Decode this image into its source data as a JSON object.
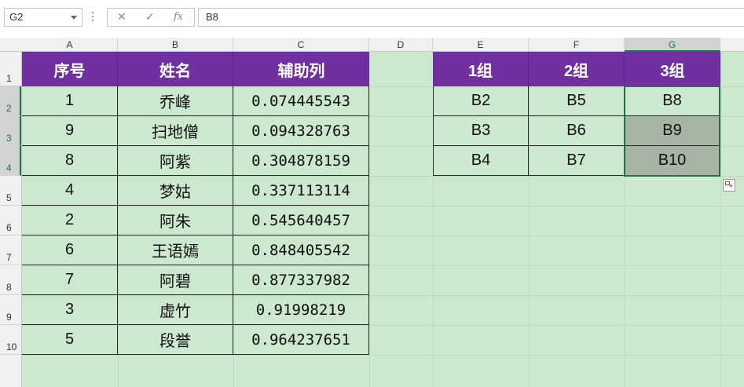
{
  "formula_bar": {
    "name_box": "G2",
    "cancel_icon": "✕",
    "enter_icon": "✓",
    "fx_label": "fx",
    "formula": "B8"
  },
  "columns": [
    "A",
    "B",
    "C",
    "D",
    "E",
    "F",
    "G"
  ],
  "rows": [
    "1",
    "2",
    "3",
    "4",
    "5",
    "6",
    "7",
    "8",
    "9",
    "10"
  ],
  "table1": {
    "headers": [
      "序号",
      "姓名",
      "辅助列"
    ],
    "rows": [
      [
        "1",
        "乔峰",
        "0.074445543"
      ],
      [
        "9",
        "扫地僧",
        "0.094328763"
      ],
      [
        "8",
        "阿紫",
        "0.304878159"
      ],
      [
        "4",
        "梦姑",
        "0.337113114"
      ],
      [
        "2",
        "阿朱",
        "0.545640457"
      ],
      [
        "6",
        "王语嫣",
        "0.848405542"
      ],
      [
        "7",
        "阿碧",
        "0.877337982"
      ],
      [
        "3",
        "虚竹",
        "0.91998219"
      ],
      [
        "5",
        "段誉",
        "0.964237651"
      ]
    ]
  },
  "table2": {
    "headers": [
      "1组",
      "2组",
      "3组"
    ],
    "rows": [
      [
        "B2",
        "B5",
        "B8"
      ],
      [
        "B3",
        "B6",
        "B9"
      ],
      [
        "B4",
        "B7",
        "B10"
      ]
    ]
  },
  "colors": {
    "header_bg": "#7030a0",
    "sheet_bg": "#cce8cf",
    "selection": "#217346"
  },
  "quick_analysis_icon": "quick-analysis-icon"
}
